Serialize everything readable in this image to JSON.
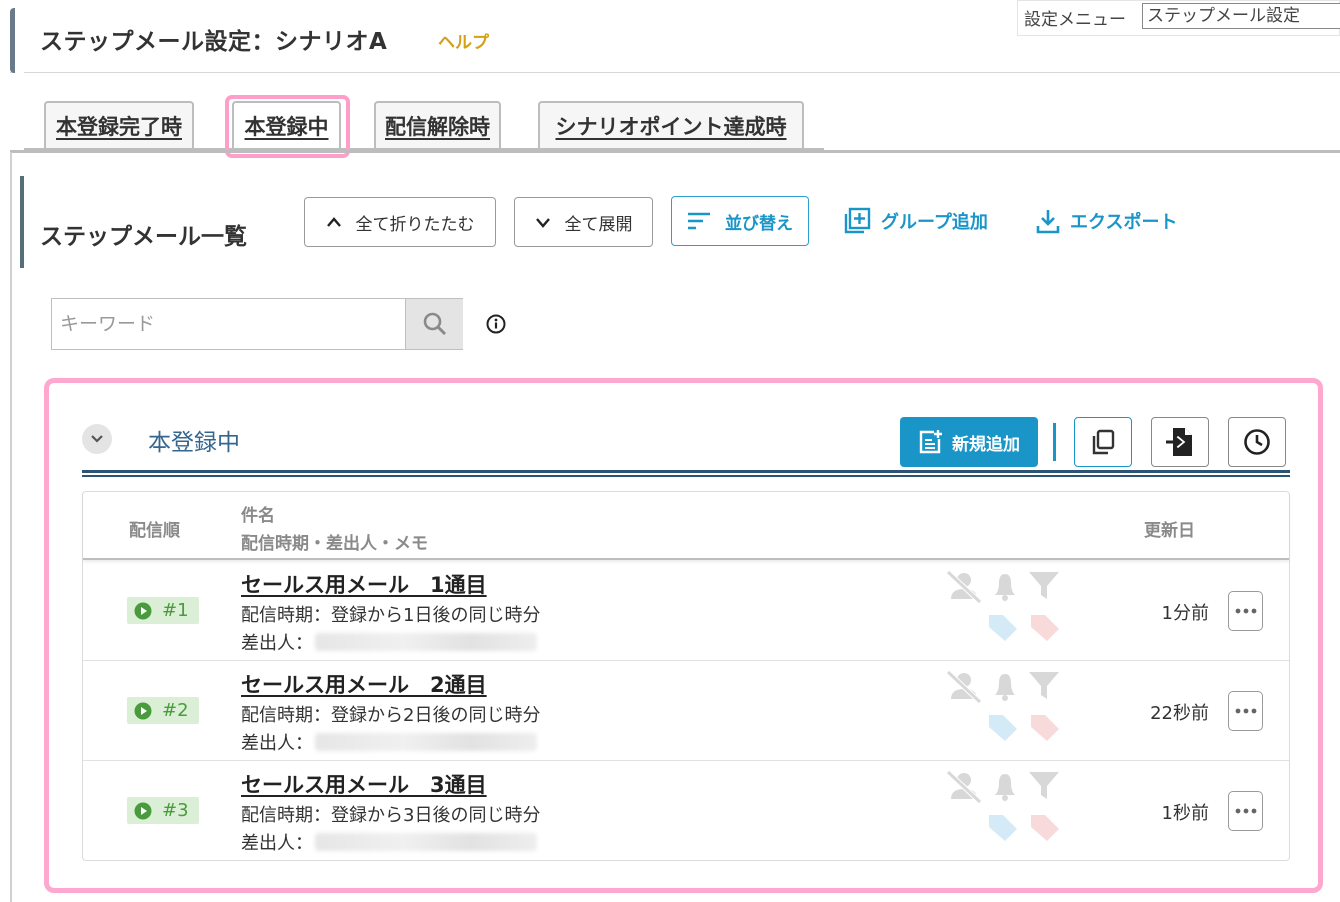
{
  "header": {
    "title": "ステップメール設定：シナリオA",
    "help": "ヘルプ",
    "settings_menu_label": "設定メニュー",
    "settings_menu_value": "ステップメール設定"
  },
  "tabs": [
    {
      "label": "本登録完了時",
      "active": false
    },
    {
      "label": "本登録中",
      "active": true
    },
    {
      "label": "配信解除時",
      "active": false
    },
    {
      "label": "シナリオポイント達成時",
      "active": false
    }
  ],
  "section": {
    "title": "ステップメール一覧",
    "collapse_all": "全て折りたたむ",
    "expand_all": "全て展開",
    "sort": "並び替え",
    "add_group": "グループ追加",
    "export": "エクスポート"
  },
  "search": {
    "placeholder": "キーワード"
  },
  "group": {
    "title": "本登録中",
    "new_button": "新規追加"
  },
  "table": {
    "col_order": "配信順",
    "col_subject": "件名",
    "col_subject_sub": "配信時期・差出人・メモ",
    "col_updated": "更新日",
    "rows": [
      {
        "order": "#1",
        "title": "セールス用メール　1通目",
        "timing": "配信時期：登録から1日後の同じ時分",
        "sender_label": "差出人：",
        "updated": "1分前"
      },
      {
        "order": "#2",
        "title": "セールス用メール　2通目",
        "timing": "配信時期：登録から2日後の同じ時分",
        "sender_label": "差出人：",
        "updated": "22秒前"
      },
      {
        "order": "#3",
        "title": "セールス用メール　3通目",
        "timing": "配信時期：登録から3日後の同じ時分",
        "sender_label": "差出人：",
        "updated": "1秒前"
      }
    ]
  },
  "colors": {
    "accent": "#1a95c8",
    "highlight": "#ffa8cf",
    "badge_bg": "#dbefd6",
    "badge_fg": "#4a9a3e"
  }
}
